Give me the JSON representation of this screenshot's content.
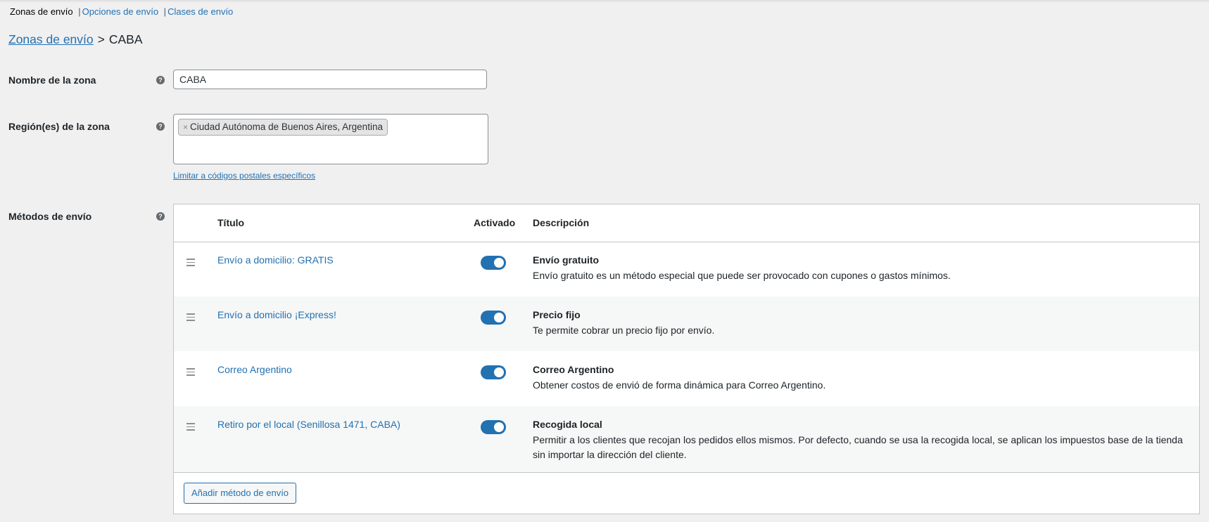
{
  "subnav": {
    "current": "Zonas de envío",
    "links": [
      "Opciones de envío",
      "Clases de envío"
    ],
    "separator": "|"
  },
  "breadcrumb": {
    "parent": "Zonas de envío",
    "separator": ">",
    "current": "CABA"
  },
  "zone_name": {
    "label": "Nombre de la zona",
    "value": "CABA"
  },
  "zone_regions": {
    "label": "Región(es) de la zona",
    "chip": "Ciudad Autónoma de Buenos Aires, Argentina",
    "chip_remove": "×",
    "limit_link": "Limitar a códigos postales específicos"
  },
  "shipping_methods": {
    "label": "Métodos de envío",
    "columns": {
      "title": "Título",
      "enabled": "Activado",
      "description": "Descripción"
    },
    "rows": [
      {
        "title": "Envío a domicilio: GRATIS",
        "enabled": true,
        "method": "Envío gratuito",
        "description": "Envío gratuito es un método especial que puede ser provocado con cupones o gastos mínimos."
      },
      {
        "title": "Envío a domicilio ¡Express!",
        "enabled": true,
        "method": "Precio fijo",
        "description": "Te permite cobrar un precio fijo por envío."
      },
      {
        "title": "Correo Argentino",
        "enabled": true,
        "method": "Correo Argentino",
        "description": "Obtener costos de envió de forma dinámica para Correo Argentino."
      },
      {
        "title": "Retiro por el local (Senillosa 1471, CABA)",
        "enabled": true,
        "method": "Recogida local",
        "description": "Permitir a los clientes que recojan los pedidos ellos mismos. Por defecto, cuando se usa la recogida local, se aplican los impuestos base de la tienda sin importar la dirección del cliente."
      }
    ],
    "add_button": "Añadir método de envío"
  },
  "help_glyph": "?",
  "colors": {
    "link": "#2271b1",
    "toggle_on": "#2271b1",
    "background": "#f0f0f1"
  }
}
